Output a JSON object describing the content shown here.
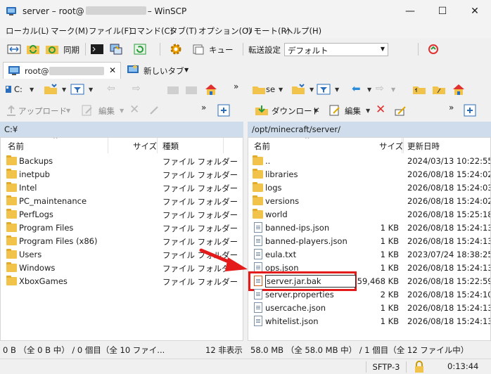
{
  "window": {
    "title_prefix": "server – root@",
    "title_suffix": "– WinSCP",
    "minimize": "—",
    "maximize": "☐",
    "close": "✕"
  },
  "menu": [
    "ローカル(L)",
    "マーク(M)",
    "ファイル(F)",
    "コマンド(C)",
    "タブ(T)",
    "オプション(O)",
    "リモート(R)",
    "ヘルプ(H)"
  ],
  "toolbar": {
    "sync_label": "同期",
    "queue_label": "キュー",
    "transfer_settings_label": "転送設定",
    "preset_value": "デフォルト"
  },
  "tabs": {
    "session_prefix": "root@",
    "new_tab": "新しいタブ"
  },
  "left_panel": {
    "drive": "C:",
    "upload_label": "アップロード",
    "edit_label": "編集",
    "path": "C:¥",
    "columns": [
      "名前",
      "サイズ",
      "種類"
    ],
    "rows": [
      {
        "name": "Backups",
        "type": "ファイル フォルダー"
      },
      {
        "name": "inetpub",
        "type": "ファイル フォルダー"
      },
      {
        "name": "Intel",
        "type": "ファイル フォルダー"
      },
      {
        "name": "PC_maintenance",
        "type": "ファイル フォルダー"
      },
      {
        "name": "PerfLogs",
        "type": "ファイル フォルダー"
      },
      {
        "name": "Program Files",
        "type": "ファイル フォルダー"
      },
      {
        "name": "Program Files (x86)",
        "type": "ファイル フォルダー"
      },
      {
        "name": "Users",
        "type": "ファイル フォルダー"
      },
      {
        "name": "Windows",
        "type": "ファイル フォルダー"
      },
      {
        "name": "XboxGames",
        "type": "ファイル フォルダー"
      }
    ],
    "status_left": "0 B （全 0 B 中） / 0 個目（全 10 ファイ...",
    "status_right": "12 非表示"
  },
  "right_panel": {
    "drive": "se",
    "download_label": "ダウンロード",
    "edit_label": "編集",
    "path": "/opt/minecraft/server/",
    "columns": [
      "名前",
      "サイズ",
      "更新日時"
    ],
    "rows": [
      {
        "name": "..",
        "size": "",
        "date": "2024/03/13 10:22:55",
        "kind": "up"
      },
      {
        "name": "libraries",
        "size": "",
        "date": "2026/08/18 15:24:02",
        "kind": "folder"
      },
      {
        "name": "logs",
        "size": "",
        "date": "2026/08/18 15:24:03",
        "kind": "folder"
      },
      {
        "name": "versions",
        "size": "",
        "date": "2026/08/18 15:24:02",
        "kind": "folder"
      },
      {
        "name": "world",
        "size": "",
        "date": "2026/08/18 15:25:18",
        "kind": "folder"
      },
      {
        "name": "banned-ips.json",
        "size": "1 KB",
        "date": "2026/08/18 15:24:13",
        "kind": "file"
      },
      {
        "name": "banned-players.json",
        "size": "1 KB",
        "date": "2026/08/18 15:24:13",
        "kind": "file"
      },
      {
        "name": "eula.txt",
        "size": "1 KB",
        "date": "2023/07/24 18:38:25",
        "kind": "file"
      },
      {
        "name": "ops.json",
        "size": "1 KB",
        "date": "2026/08/18 15:24:13",
        "kind": "file"
      },
      {
        "name": "server.jar.bak",
        "size": "59,468 KB",
        "date": "2026/08/18 15:22:59",
        "kind": "jar"
      },
      {
        "name": "server.properties",
        "size": "2 KB",
        "date": "2026/08/18 15:24:10",
        "kind": "file"
      },
      {
        "name": "usercache.json",
        "size": "1 KB",
        "date": "2026/08/18 15:24:13",
        "kind": "file"
      },
      {
        "name": "whitelist.json",
        "size": "1 KB",
        "date": "2026/08/18 15:24:13",
        "kind": "file"
      }
    ],
    "status": "58.0 MB （全 58.0 MB 中） / 1 個目（全 12 ファイル中）"
  },
  "bottom_status": {
    "protocol": "SFTP-3",
    "time": "0:13:44"
  },
  "colors": {
    "path_bar": "#cfdceb",
    "highlight_border": "#e31b1b",
    "arrow": "#e31b1b",
    "folder": "#f2c34a"
  }
}
